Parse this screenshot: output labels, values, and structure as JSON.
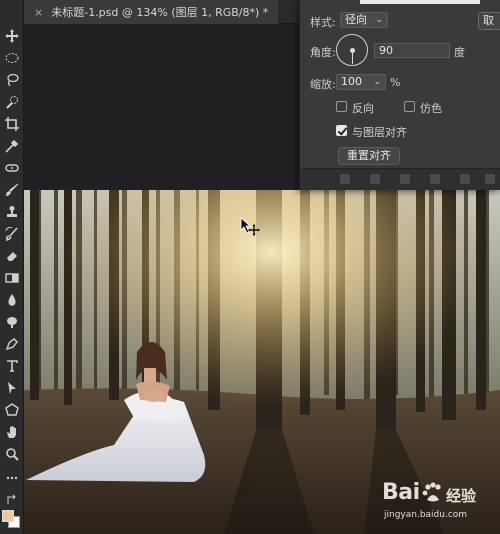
{
  "document": {
    "tab_close": "×",
    "tab_title": "未标题-1.psd @ 134% (图层 1, RGB/8*) *"
  },
  "toolbar": {
    "tools": [
      "move-icon",
      "marquee-icon",
      "lasso-icon",
      "quick-select-icon",
      "crop-icon",
      "eyedropper-icon",
      "healing-icon",
      "brush-icon",
      "stamp-icon",
      "history-brush-icon",
      "eraser-icon",
      "gradient-icon",
      "blur-icon",
      "dodge-icon",
      "pen-icon",
      "type-icon",
      "path-select-icon",
      "shape-icon",
      "hand-icon",
      "zoom-icon",
      "more-icon"
    ],
    "foreground_color": "#e8c9a0",
    "background_color": "#ffffff"
  },
  "gradient_dialog": {
    "style_label": "样式:",
    "style_value": "径向",
    "angle_label": "角度:",
    "angle_value": "90",
    "angle_unit": "度",
    "scale_label": "缩放:",
    "scale_value": "100",
    "scale_unit": "%",
    "reverse_label": "反向",
    "reverse_checked": false,
    "dither_label": "仿色",
    "dither_checked": false,
    "align_label": "与图层对齐",
    "align_checked": true,
    "reset_align_label": "重置对齐",
    "cancel_fragment": "取"
  },
  "watermark": {
    "brand": "Bai",
    "brand_cn": "经验",
    "url": "jingyan.baidu.com"
  }
}
